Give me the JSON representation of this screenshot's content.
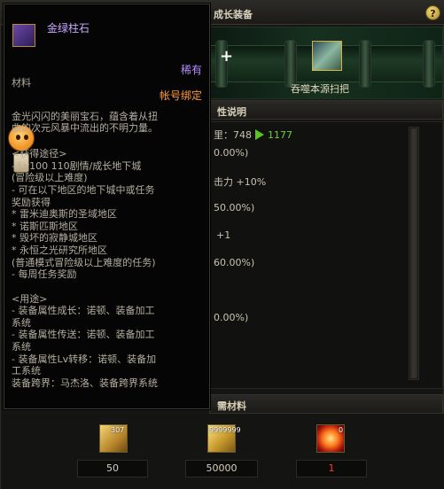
{
  "window": {
    "title": "成长装备",
    "help_label": "?"
  },
  "target": {
    "plus_label": "+",
    "item_name": "吞噬本源扫把"
  },
  "properties": {
    "header": "性说明",
    "rows": [
      {
        "a": "里：748",
        "b": "1177"
      },
      {
        "a": "0.00%)"
      },
      {
        "a": "击力 +10%"
      },
      {
        "a": "50.00%)"
      },
      {
        "a": "+1"
      },
      {
        "a": "60.00%)"
      },
      {
        "a": "0.00%)"
      }
    ]
  },
  "materials": {
    "header": "需材料",
    "items": [
      {
        "icon": "gold-crystal-icon",
        "count": "307",
        "value": "50"
      },
      {
        "icon": "gold-coins-icon",
        "count": "9999999",
        "value": "50000"
      },
      {
        "icon": "red-orb-icon",
        "count": "0",
        "value": "1"
      }
    ]
  },
  "tooltip": {
    "name": "金绿柱石",
    "rarity": "稀有",
    "type": "材料",
    "bind": "帐号绑定",
    "lines": [
      "金光闪闪的美丽宝石，蕴含着从扭",
      "曲的次元风暴中流出的不明力量。",
      "",
      "<获得途径>",
      "- Lv100 110剧情/成长地下城",
      "  (冒险级以上难度)",
      "- 可在以下地区的地下城中或任务",
      "奖励获得",
      "  * 雷米迪奥斯的圣域地区",
      "  * 诺斯匹斯地区",
      "  * 毁坏的寂静城地区",
      "  * 永恒之光研究所地区",
      "  (普通模式冒险级以上难度的任务)",
      "- 每周任务奖励",
      "",
      "<用途>",
      "- 装备属性成长：诺顿、装备加工",
      "系统",
      "- 装备属性传送：诺顿、装备加工",
      "系统",
      "- 装备属性Lv转移：诺顿、装备加",
      "工系统",
      "装备跨界：马杰洛、装备跨界系统"
    ]
  },
  "colors": {
    "rare": "#b48cff",
    "bind": "#ff9a3a",
    "upgrade": "#6fcf3a",
    "missing": "#ff3a2a"
  }
}
